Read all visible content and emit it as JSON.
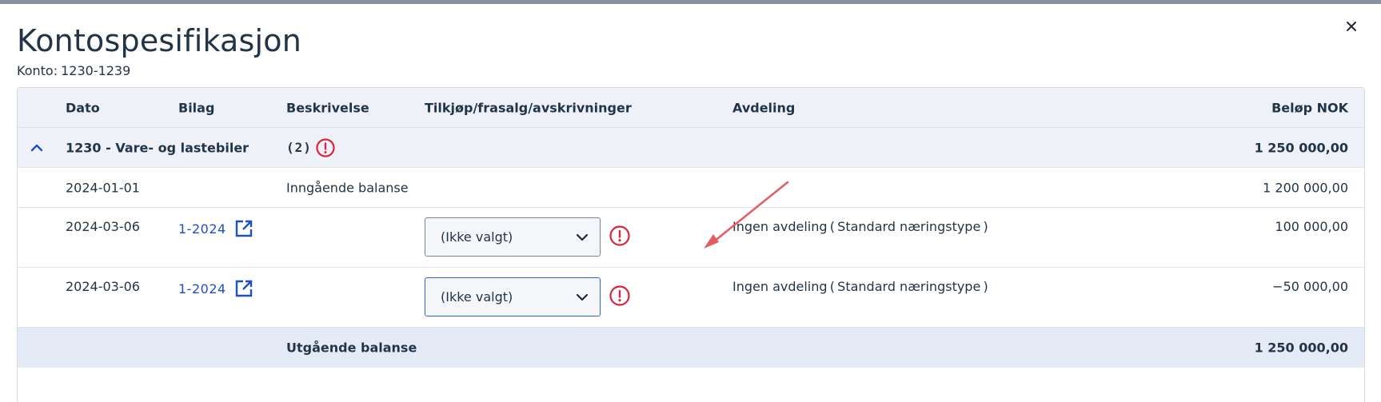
{
  "window": {
    "title": "Kontospesifikasjon",
    "subtitle_label": "Konto:",
    "subtitle_value": "1230-1239",
    "close_symbol": "×"
  },
  "colors": {
    "accent": "#1f4fc8",
    "warning": "#d7263d",
    "annotation_arrow": "#e45b61",
    "header_bg": "#eef2f8",
    "footer_bg": "#e4ebf7"
  },
  "table": {
    "columns": {
      "dato": "Dato",
      "bilag": "Bilag",
      "beskrivelse": "Beskrivelse",
      "tilkjop": "Tilkjøp/frasalg/avskrivninger",
      "avdeling": "Avdeling",
      "belop": "Beløp NOK"
    },
    "group": {
      "name": "1230 - Vare- og lastebiler",
      "count": "(2)",
      "total": "1 250 000,00",
      "expanded": true,
      "icons": [
        "chevron-up-icon",
        "warning-icon"
      ]
    },
    "rows": [
      {
        "dato": "2024-01-01",
        "bilag": "",
        "beskrivelse": "Inngående balanse",
        "tilkjop": "",
        "avdeling": "",
        "belop": "1 200 000,00"
      },
      {
        "dato": "2024-03-06",
        "bilag": "1-2024",
        "beskrivelse": "",
        "tilkjop": "(Ikke valgt)",
        "avdeling": "Ingen avdeling ( Standard næringstype )",
        "belop": "100 000,00"
      },
      {
        "dato": "2024-03-06",
        "bilag": "1-2024",
        "beskrivelse": "",
        "tilkjop": "(Ikke valgt)",
        "avdeling": "Ingen avdeling ( Standard næringstype )",
        "belop": "−50 000,00"
      }
    ],
    "footer": {
      "label": "Utgående balanse",
      "total": "1 250 000,00"
    }
  }
}
